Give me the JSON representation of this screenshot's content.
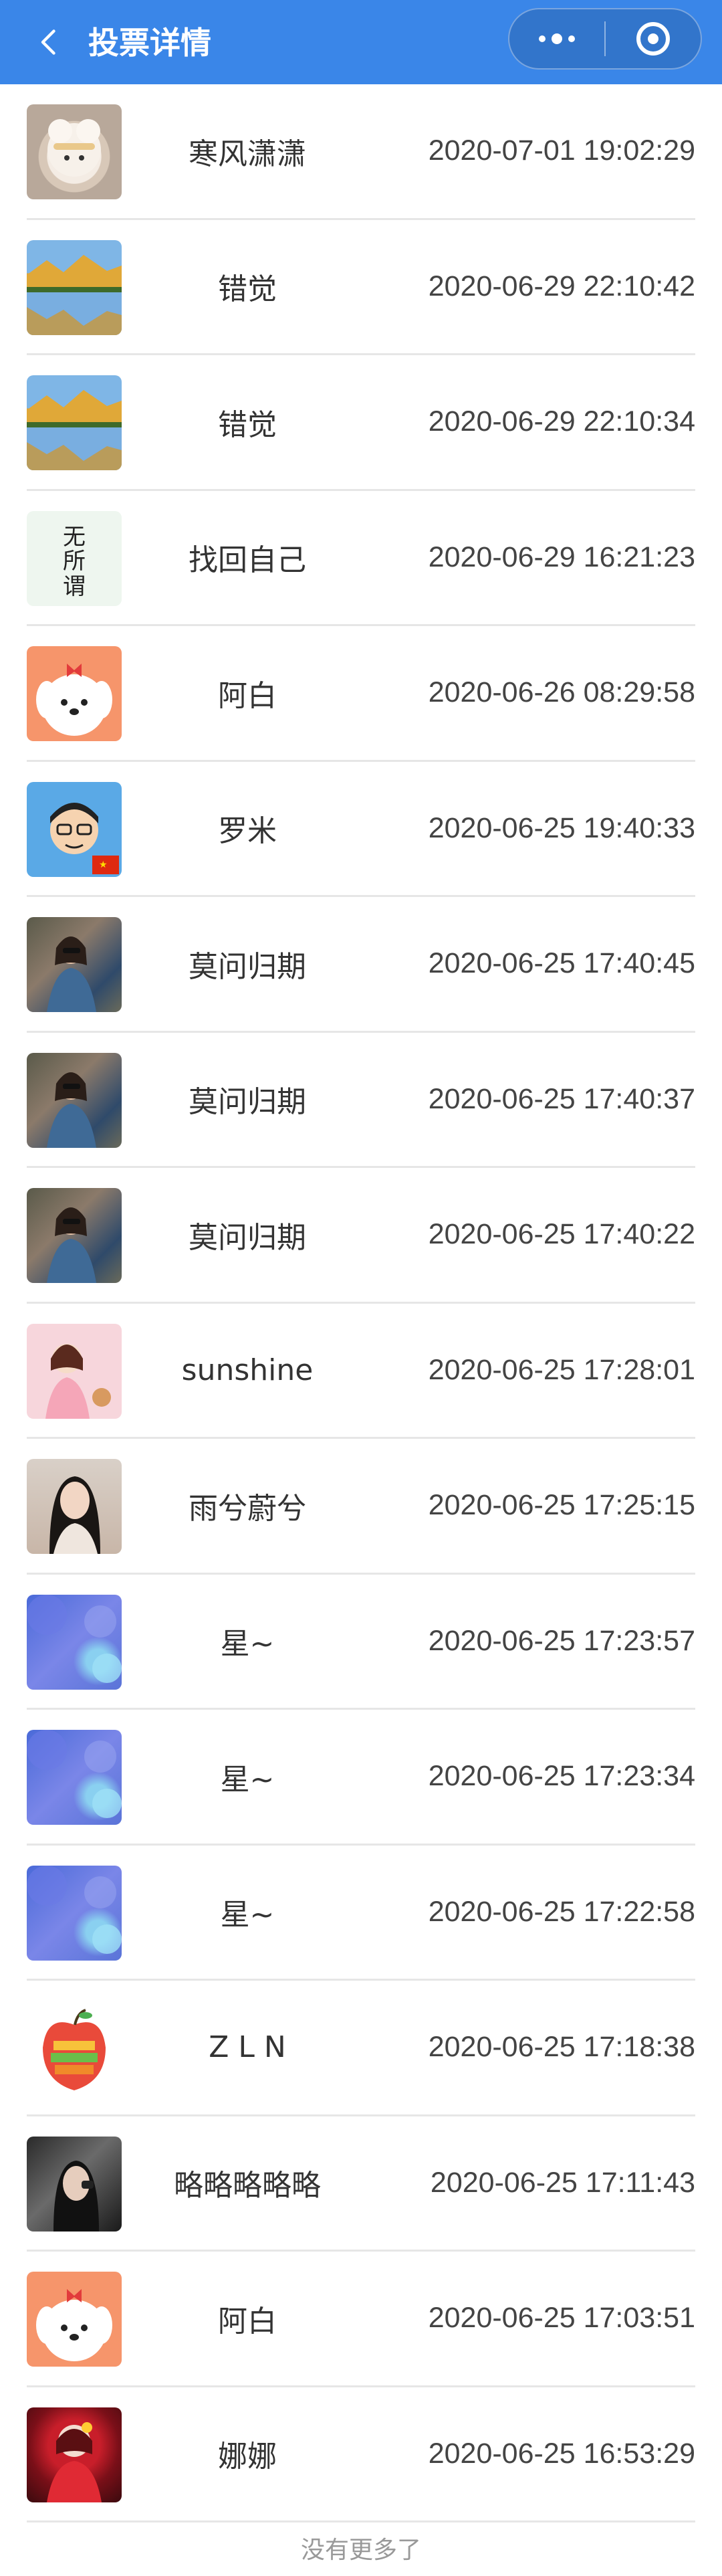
{
  "header": {
    "title": "投票详情",
    "back_icon": "chevron-left-icon",
    "more_icon": "more-dots-icon",
    "close_icon": "target-circle-icon",
    "background_color": "#3a86e8"
  },
  "votes": [
    {
      "name": "寒风潇潇",
      "time": "2020-07-01 19:02:29",
      "avatar": "sheep"
    },
    {
      "name": "错觉",
      "time": "2020-06-29 22:10:42",
      "avatar": "lake"
    },
    {
      "name": "错觉",
      "time": "2020-06-29 22:10:34",
      "avatar": "lake"
    },
    {
      "name": "找回自己",
      "time": "2020-06-29 16:21:23",
      "avatar": "ink"
    },
    {
      "name": "阿白",
      "time": "2020-06-26 08:29:58",
      "avatar": "dog"
    },
    {
      "name": "罗米",
      "time": "2020-06-25 19:40:33",
      "avatar": "cartoon"
    },
    {
      "name": "莫问归期",
      "time": "2020-06-25 17:40:45",
      "avatar": "girl"
    },
    {
      "name": "莫问归期",
      "time": "2020-06-25 17:40:37",
      "avatar": "girl"
    },
    {
      "name": "莫问归期",
      "time": "2020-06-25 17:40:22",
      "avatar": "girl"
    },
    {
      "name": "sunshine",
      "time": "2020-06-25 17:28:01",
      "avatar": "pink"
    },
    {
      "name": "雨兮蔚兮",
      "time": "2020-06-25 17:25:15",
      "avatar": "portrait"
    },
    {
      "name": "星~",
      "time": "2020-06-25 17:23:57",
      "avatar": "sky"
    },
    {
      "name": "星~",
      "time": "2020-06-25 17:23:34",
      "avatar": "sky"
    },
    {
      "name": "星~",
      "time": "2020-06-25 17:22:58",
      "avatar": "sky"
    },
    {
      "name": "Z L N",
      "time": "2020-06-25 17:18:38",
      "avatar": "apple"
    },
    {
      "name": "略略略略略",
      "time": "2020-06-25 17:11:43",
      "avatar": "dark"
    },
    {
      "name": "阿白",
      "time": "2020-06-25 17:03:51",
      "avatar": "dog"
    },
    {
      "name": "娜娜",
      "time": "2020-06-25 16:53:29",
      "avatar": "red"
    }
  ],
  "footer": {
    "text": "没有更多了"
  }
}
